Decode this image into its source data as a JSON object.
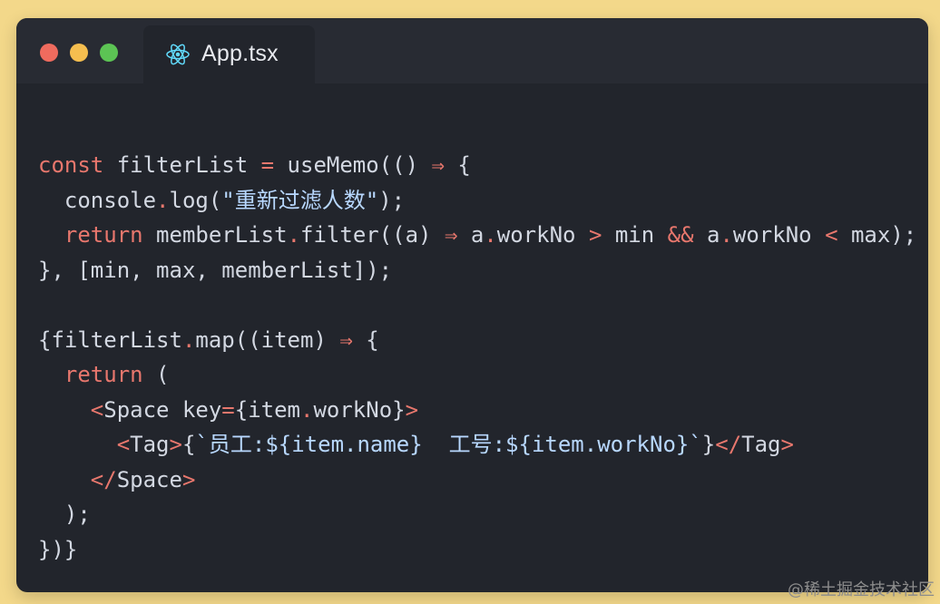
{
  "window": {
    "tab_title": "App.tsx",
    "tab_icon": "react-icon"
  },
  "colors": {
    "page_background": "#f3d88a",
    "editor_background": "#22252c",
    "titlebar_background": "#282b33",
    "keyword": "#e8776d",
    "string": "#b8d8ff",
    "text": "#d3d8e2",
    "close": "#ef6b5e",
    "minimize": "#f5be4f",
    "maximize": "#5cc454"
  },
  "code_lines": [
    {
      "tokens": [
        {
          "t": "kw",
          "v": "const"
        },
        {
          "t": "plain",
          "v": " filterList "
        },
        {
          "t": "op",
          "v": "="
        },
        {
          "t": "plain",
          "v": " useMemo(() "
        },
        {
          "t": "op",
          "v": "⇒"
        },
        {
          "t": "plain",
          "v": " {"
        }
      ]
    },
    {
      "tokens": [
        {
          "t": "plain",
          "v": "  console"
        },
        {
          "t": "op",
          "v": "."
        },
        {
          "t": "plain",
          "v": "log("
        },
        {
          "t": "str",
          "v": "\"重新过滤人数\""
        },
        {
          "t": "plain",
          "v": ");"
        }
      ]
    },
    {
      "tokens": [
        {
          "t": "plain",
          "v": "  "
        },
        {
          "t": "kw",
          "v": "return"
        },
        {
          "t": "plain",
          "v": " memberList"
        },
        {
          "t": "op",
          "v": "."
        },
        {
          "t": "plain",
          "v": "filter((a) "
        },
        {
          "t": "op",
          "v": "⇒"
        },
        {
          "t": "plain",
          "v": " a"
        },
        {
          "t": "op",
          "v": "."
        },
        {
          "t": "plain",
          "v": "workNo "
        },
        {
          "t": "op",
          "v": ">"
        },
        {
          "t": "plain",
          "v": " min "
        },
        {
          "t": "op",
          "v": "&&"
        },
        {
          "t": "plain",
          "v": " a"
        },
        {
          "t": "op",
          "v": "."
        },
        {
          "t": "plain",
          "v": "workNo "
        },
        {
          "t": "op",
          "v": "<"
        },
        {
          "t": "plain",
          "v": " max);"
        }
      ]
    },
    {
      "tokens": [
        {
          "t": "plain",
          "v": "}, [min, max, memberList]);"
        }
      ]
    },
    {
      "tokens": []
    },
    {
      "tokens": [
        {
          "t": "plain",
          "v": "{filterList"
        },
        {
          "t": "op",
          "v": "."
        },
        {
          "t": "plain",
          "v": "map((item) "
        },
        {
          "t": "op",
          "v": "⇒"
        },
        {
          "t": "plain",
          "v": " {"
        }
      ]
    },
    {
      "tokens": [
        {
          "t": "plain",
          "v": "  "
        },
        {
          "t": "kw",
          "v": "return"
        },
        {
          "t": "plain",
          "v": " ("
        }
      ]
    },
    {
      "tokens": [
        {
          "t": "plain",
          "v": "    "
        },
        {
          "t": "tag",
          "v": "<"
        },
        {
          "t": "plain",
          "v": "Space key"
        },
        {
          "t": "op",
          "v": "="
        },
        {
          "t": "plain",
          "v": "{item"
        },
        {
          "t": "op",
          "v": "."
        },
        {
          "t": "plain",
          "v": "workNo}"
        },
        {
          "t": "tag",
          "v": ">"
        }
      ]
    },
    {
      "tokens": [
        {
          "t": "plain",
          "v": "      "
        },
        {
          "t": "tag",
          "v": "<"
        },
        {
          "t": "plain",
          "v": "Tag"
        },
        {
          "t": "tag",
          "v": ">"
        },
        {
          "t": "plain",
          "v": "{"
        },
        {
          "t": "str",
          "v": "`员工:${item.name}  工号:${item.workNo}`"
        },
        {
          "t": "plain",
          "v": "}"
        },
        {
          "t": "tag",
          "v": "</"
        },
        {
          "t": "plain",
          "v": "Tag"
        },
        {
          "t": "tag",
          "v": ">"
        }
      ]
    },
    {
      "tokens": [
        {
          "t": "plain",
          "v": "    "
        },
        {
          "t": "tag",
          "v": "</"
        },
        {
          "t": "plain",
          "v": "Space"
        },
        {
          "t": "tag",
          "v": ">"
        }
      ]
    },
    {
      "tokens": [
        {
          "t": "plain",
          "v": "  );"
        }
      ]
    },
    {
      "tokens": [
        {
          "t": "plain",
          "v": "})}"
        }
      ]
    }
  ],
  "watermark": "@稀土掘金技术社区"
}
